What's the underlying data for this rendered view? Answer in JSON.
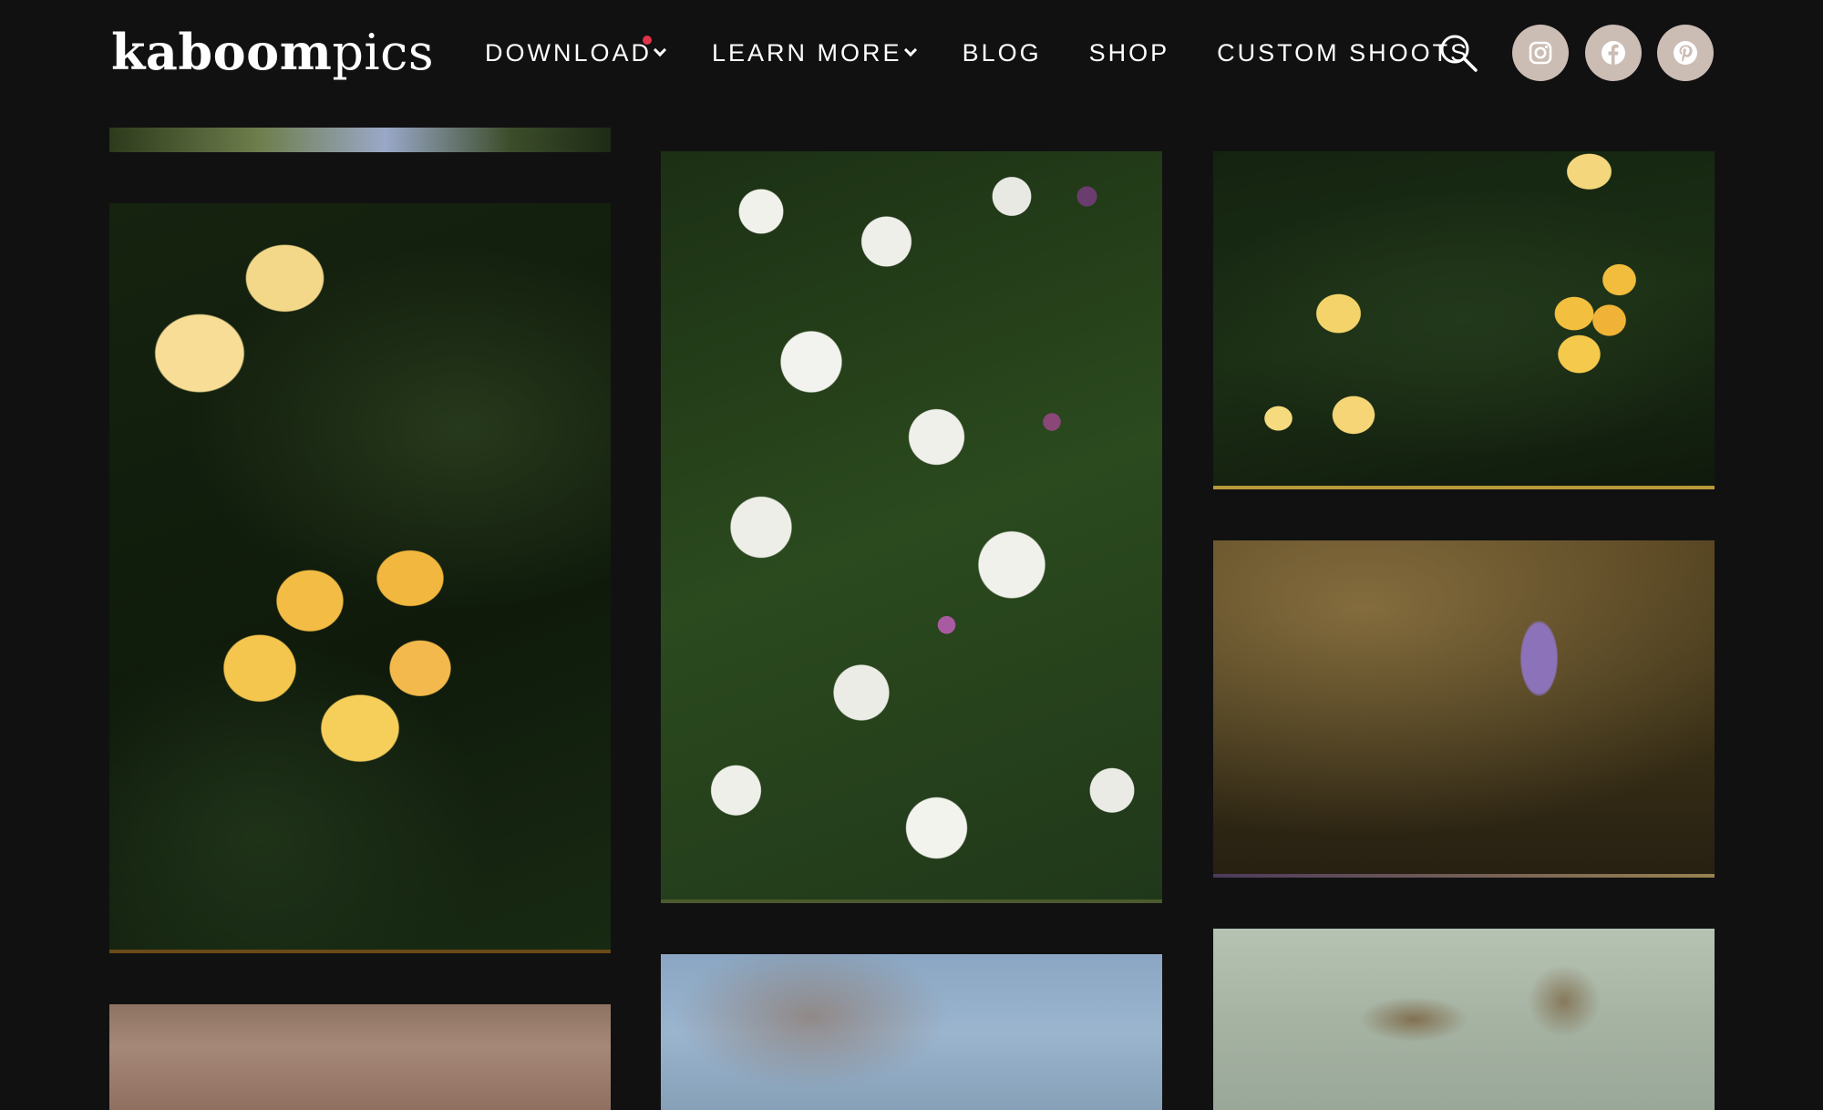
{
  "brand": {
    "logo_bold": "kaboom",
    "logo_light": "pics"
  },
  "nav": {
    "download": "DOWNLOAD",
    "learn_more": "LEARN MORE",
    "blog": "BLOG",
    "shop": "SHOP",
    "custom_shoots": "CUSTOM SHOOTS"
  },
  "icons": {
    "search": "search-icon",
    "instagram": "instagram-icon",
    "facebook": "facebook-icon",
    "pinterest": "pinterest-icon"
  },
  "colors": {
    "background": "#111112",
    "social_button": "#cbbcb4",
    "notification_dot": "#e0344a"
  }
}
